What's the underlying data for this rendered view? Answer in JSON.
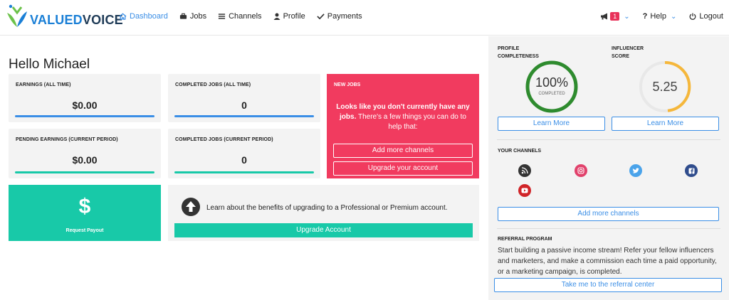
{
  "brand": {
    "part1": "VALUED",
    "part2": "VOICE"
  },
  "nav": {
    "items": [
      {
        "label": "Dashboard",
        "icon": "home-icon",
        "active": true
      },
      {
        "label": "Jobs",
        "icon": "briefcase-icon"
      },
      {
        "label": "Channels",
        "icon": "list-icon"
      },
      {
        "label": "Profile",
        "icon": "user-icon"
      },
      {
        "label": "Payments",
        "icon": "check-icon"
      }
    ],
    "notifications_count": "1",
    "help_label": "Help",
    "logout_label": "Logout"
  },
  "greeting": "Hello Michael",
  "stats": {
    "earnings_all_time": {
      "title": "EARNINGS (ALL TIME)",
      "value": "$0.00"
    },
    "completed_all_time": {
      "title": "COMPLETED JOBS (ALL TIME)",
      "value": "0"
    },
    "pending_earnings": {
      "title": "PENDING EARNINGS (CURRENT PERIOD)",
      "value": "$0.00"
    },
    "completed_current": {
      "title": "COMPLETED JOBS (CURRENT PERIOD)",
      "value": "0"
    }
  },
  "new_jobs": {
    "title": "NEW JOBS",
    "text_bold": "Looks like you don't currently have any jobs.",
    "text_rest": " There's a few things you can do to help that:",
    "add_channels_label": "Add more channels",
    "upgrade_label": "Upgrade your account"
  },
  "payout": {
    "symbol": "$",
    "label": "Request Payout"
  },
  "upgrade_panel": {
    "text": "Learn about the benefits of upgrading to a Professional or Premium account.",
    "button_label": "Upgrade Account"
  },
  "sidebar": {
    "profile_completeness": {
      "title_line1": "PROFILE",
      "title_line2": "COMPLETENESS",
      "value": "100%",
      "caption": "COMPLETED",
      "fraction": 1.0,
      "color": "#2e8b2e",
      "learn_more": "Learn More"
    },
    "influencer_score": {
      "title_line1": "INFLUENCER",
      "title_line2": "SCORE",
      "value": "5.25",
      "color": "#f5b73b",
      "learn_more": "Learn More"
    },
    "channels_title": "YOUR CHANNELS",
    "channels": [
      {
        "icon": "rss-icon",
        "color": "#333333"
      },
      {
        "icon": "instagram-icon",
        "color": "#e1416b"
      },
      {
        "icon": "twitter-icon",
        "color": "#4aa3ea"
      },
      {
        "icon": "facebook-icon",
        "color": "#2f4c8c"
      },
      {
        "icon": "youtube-icon",
        "color": "#d02428"
      }
    ],
    "add_channels_label": "Add more channels",
    "referral_title": "REFERRAL PROGRAM",
    "referral_text": "Start building a passive income stream! Refer your fellow influencers and marketers, and make a commission each time a paid opportunity, or a marketing campaign, is completed.",
    "referral_button": "Take me to the referral center"
  },
  "colors": {
    "accent": "#3a8ee6",
    "teal": "#18c9a8",
    "pink": "#f13b5f"
  }
}
